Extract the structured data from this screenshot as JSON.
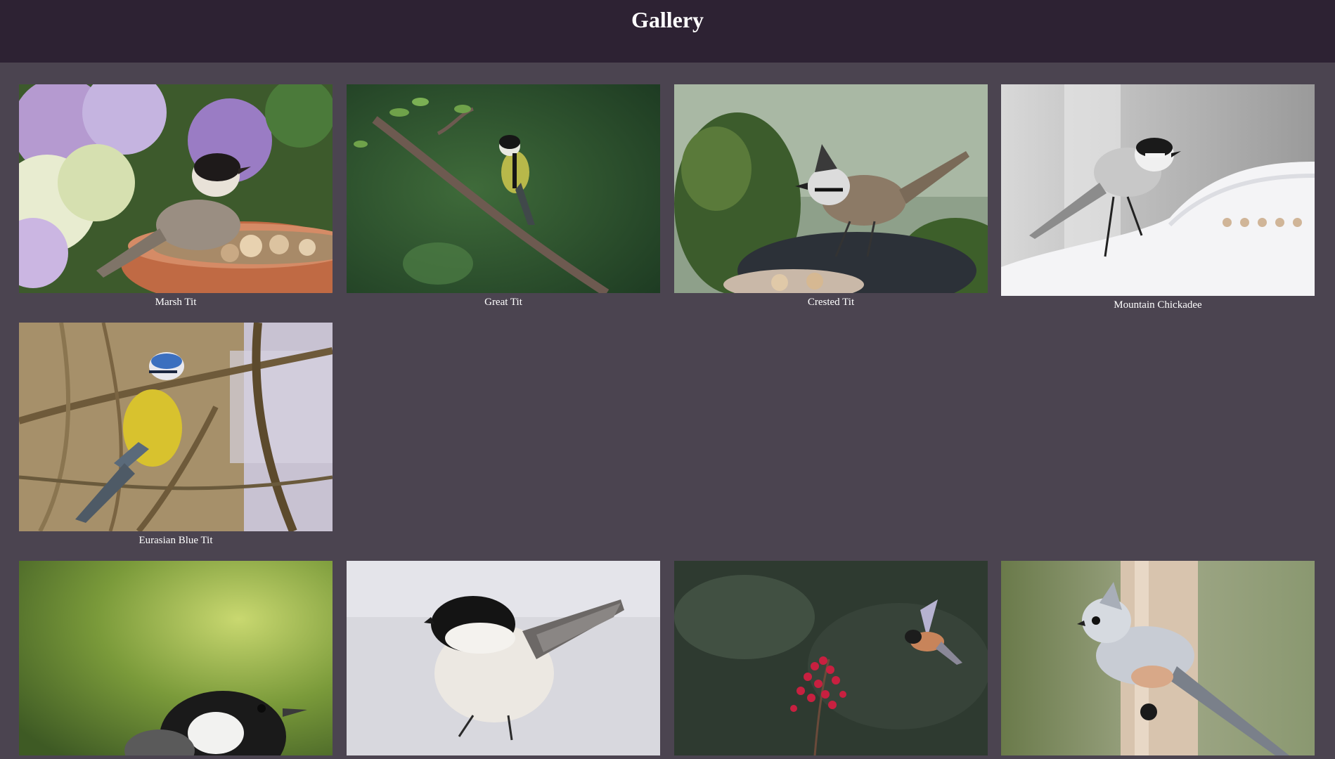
{
  "header": {
    "title": "Gallery"
  },
  "gallery": {
    "items": [
      {
        "caption": "Marsh Tit"
      },
      {
        "caption": "Great Tit"
      },
      {
        "caption": "Crested Tit"
      },
      {
        "caption": "Mountain Chickadee"
      },
      {
        "caption": "Eurasian Blue Tit"
      },
      {
        "caption": ""
      },
      {
        "caption": ""
      },
      {
        "caption": ""
      },
      {
        "caption": ""
      }
    ]
  },
  "colors": {
    "page_background": "#4b4450",
    "header_background": "#2d2233",
    "text": "#ffffff"
  }
}
